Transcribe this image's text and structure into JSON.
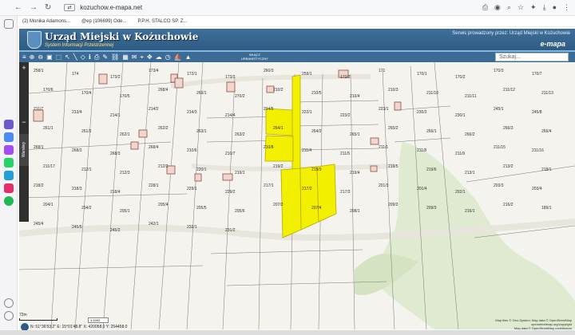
{
  "browser": {
    "url": "kozuchow.e-mapa.net",
    "bookmarks": [
      "(2) Monika Adamons...",
      "@ep (106699) Ode...",
      "P.P.H. STALCO SP. Z..."
    ]
  },
  "header": {
    "title": "Urząd Miejski w Kożuchowie",
    "subtitle": "System Informacji Przestrzennej",
    "right_text": "Serwis prowadzony przez: Urząd Miejski w Kożuchowie",
    "brand": "e-mapa",
    "accent": "#2e5b83"
  },
  "toolbar": {
    "legend_button": "WŁĄCZ\nURBANISTYCZNY",
    "search_placeholder": "Szukaj..."
  },
  "side_panel": {
    "tab_label": "Warstwy"
  },
  "map": {
    "highlight_color": "#f2f000",
    "parcels": [
      "258/1",
      "174",
      "173/2",
      "173/4",
      "172/1",
      "173/3",
      "260/3",
      "259/1",
      "172/2",
      "171",
      "170/1",
      "170/2",
      "170/3",
      "170/7",
      "170/6",
      "170/4",
      "170/5",
      "268/4",
      "269/1",
      "270/2",
      "210/2",
      "210/5",
      "210/4",
      "210/3",
      "211/10",
      "211/11",
      "211/12",
      "211/13",
      "211/7",
      "213/4",
      "214/1",
      "214/2",
      "214/3",
      "214/4",
      "214/5",
      "222/1",
      "223/2",
      "223/1",
      "230/2",
      "230/1",
      "245/1",
      "245/8",
      "261/1",
      "261/2",
      "262/1",
      "262/2",
      "263/1",
      "263/2",
      "264/1",
      "264/2",
      "265/1",
      "265/2",
      "266/1",
      "266/2",
      "266/3",
      "266/4",
      "268/1",
      "268/2",
      "268/3",
      "268/4",
      "210/6",
      "210/7",
      "210/8",
      "211/4",
      "211/5",
      "211/1",
      "211/8",
      "211/9",
      "211/15",
      "211/16",
      "211/17",
      "212/1",
      "212/3",
      "212/2",
      "220/1",
      "219/1",
      "219/2",
      "219/3",
      "219/4",
      "219/5",
      "219/6",
      "213/1",
      "213/2",
      "218/1",
      "218/2",
      "218/3",
      "218/4",
      "228/1",
      "229/1",
      "229/2",
      "217/1",
      "217/2",
      "217/3",
      "201/3",
      "201/4",
      "202/1",
      "203/3",
      "203/4",
      "204/1",
      "204/2",
      "205/1",
      "205/4",
      "205/5",
      "205/6",
      "207/2",
      "207/4",
      "208/1",
      "209/2",
      "209/3",
      "216/1",
      "216/2",
      "189/1",
      "245/4",
      "245/5",
      "245/2",
      "242/1",
      "232/1",
      "231/2"
    ],
    "scale_label": "72m",
    "scale_select": "1:1992",
    "coords": "N: 51°36'53.2\" E: 15°01'48.8\" X: 420058.0 Y: 254458.0",
    "attribution_1": "Map tiles © Geo-System; Map data © OpenStreetMap",
    "attribution_2": "openstreetmap.org/copyright",
    "attribution_3": "Map data © OpenStreetMap contributors"
  }
}
